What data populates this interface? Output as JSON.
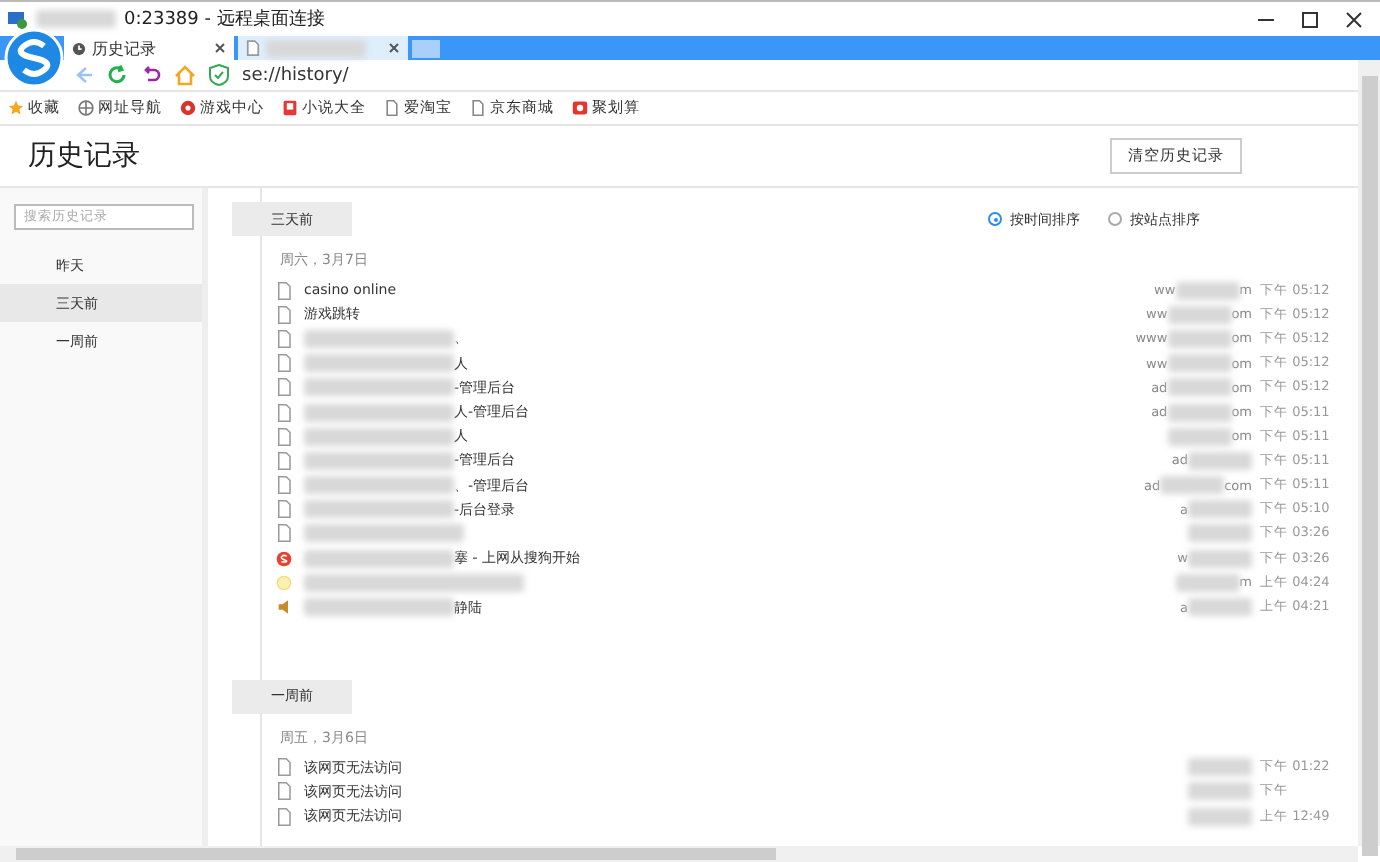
{
  "window": {
    "title": "0:23389 - 远程桌面连接"
  },
  "tabs": [
    {
      "label": "历史记录",
      "selected": true
    },
    {
      "selected": false
    }
  ],
  "address": "se://history/",
  "bookmarks": [
    {
      "label": "收藏",
      "kind": "star"
    },
    {
      "label": "网址导航",
      "kind": "globe"
    },
    {
      "label": "游戏中心",
      "kind": "game"
    },
    {
      "label": "小说大全",
      "kind": "book"
    },
    {
      "label": "爱淘宝",
      "kind": "page"
    },
    {
      "label": "京东商城",
      "kind": "page"
    },
    {
      "label": "聚划算",
      "kind": "deal"
    }
  ],
  "page": {
    "title": "历史记录",
    "clear_button": "清空历史记录"
  },
  "search": {
    "placeholder": "搜索历史记录"
  },
  "sidebar": {
    "items": [
      {
        "label": "昨天",
        "selected": false
      },
      {
        "label": "三天前",
        "selected": true
      },
      {
        "label": "一周前",
        "selected": false
      }
    ]
  },
  "sort": [
    {
      "label": "按时间排序",
      "selected": true
    },
    {
      "label": "按站点排序",
      "selected": false
    }
  ],
  "groups": [
    {
      "label": "三天前",
      "date": "周六，3月7日",
      "rows": [
        {
          "kind": "page",
          "title": "casino online",
          "domain_start": "ww",
          "domain_end": "m",
          "time": "下午 05:12"
        },
        {
          "kind": "page",
          "title": "游戏跳转",
          "domain_start": "ww",
          "domain_end": "om",
          "time": "下午 05:12"
        },
        {
          "kind": "page",
          "title": "、",
          "domain_start": "www",
          "domain_end": "om",
          "time": "下午 05:12"
        },
        {
          "kind": "page",
          "title": "人",
          "domain_start": "ww",
          "domain_end": "om",
          "time": "下午 05:12"
        },
        {
          "kind": "page",
          "title": "-管理后台",
          "domain_start": "ad",
          "domain_end": "om",
          "time": "下午 05:12"
        },
        {
          "kind": "page",
          "title": "人-管理后台",
          "domain_start": "ad",
          "domain_end": "om",
          "time": "下午 05:11"
        },
        {
          "kind": "page",
          "title": "人",
          "domain_end": "om",
          "time": "下午 05:11"
        },
        {
          "kind": "page",
          "title": "-管理后台",
          "domain_start": "ad",
          "time": "下午 05:11"
        },
        {
          "kind": "page",
          "title": "、-管理后台",
          "domain_start": "ad",
          "domain_end": "com",
          "time": "下午 05:11"
        },
        {
          "kind": "page",
          "title": "-后台登录",
          "domain_start": "a",
          "time": "下午 05:10"
        },
        {
          "kind": "page",
          "time": "下午 03:26"
        },
        {
          "kind": "sogou",
          "title": "搴 - 上网从搜狗开始",
          "domain_start": "w",
          "time": "下午 03:26"
        },
        {
          "kind": "sun",
          "domain_end": "m",
          "time": "上午 04:24"
        },
        {
          "kind": "speaker",
          "title": "静陆",
          "domain_start": "a",
          "time": "上午 04:21"
        }
      ]
    },
    {
      "label": "一周前",
      "date": "周五，3月6日",
      "rows": [
        {
          "kind": "page",
          "title": "该网页无法访问",
          "time": "下午 01:22"
        },
        {
          "kind": "page",
          "title": "该网页无法访问",
          "time": "下午"
        },
        {
          "kind": "page",
          "title": "该网页无法访问",
          "time": "上午 12:49"
        }
      ]
    }
  ]
}
